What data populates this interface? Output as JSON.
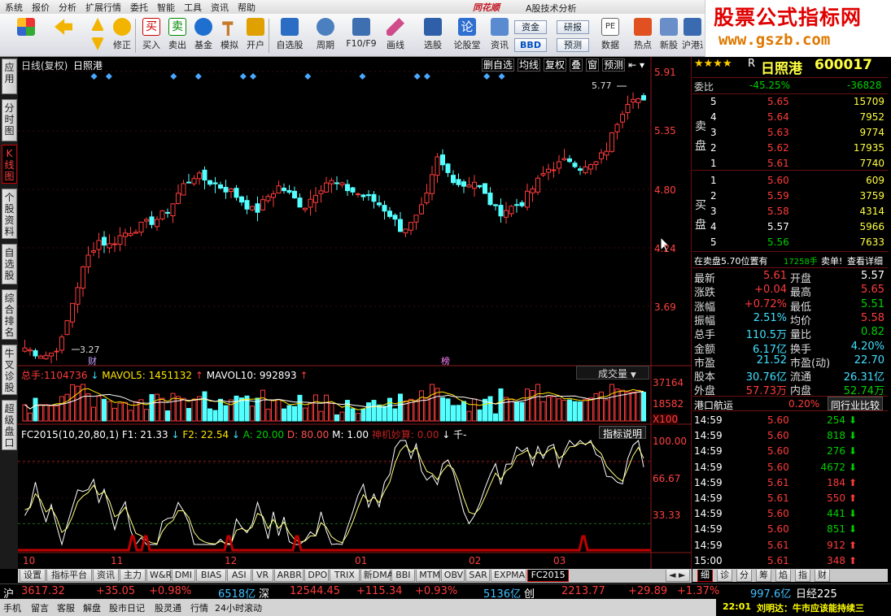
{
  "menu": {
    "items": [
      "系统",
      "报价",
      "分析",
      "扩展行情",
      "委托",
      "智能",
      "工具",
      "资讯",
      "帮助"
    ],
    "brand": "同花顺",
    "subtitle": "A股技术分析"
  },
  "banner": {
    "line1": "股票公式指标网",
    "line2": "www.gszb.com"
  },
  "toolbar": {
    "buttons": [
      "修正",
      "买入",
      "卖出",
      "基金",
      "模拟",
      "开户",
      "自选股",
      "周期",
      "F10/F9",
      "画线",
      "选股",
      "论股堂",
      "资讯",
      "数据",
      "热点",
      "新股",
      "沪港通"
    ],
    "box1": "资金",
    "box2": "BBD",
    "box3": "研报",
    "box4": "预测",
    "pe": "PE"
  },
  "left_tabs": [
    "应用",
    "分时图",
    "K线图",
    "个股资料",
    "自选股",
    "综合排名",
    "牛叉诊股",
    "超级盘口"
  ],
  "chart": {
    "title": "日线(复权)",
    "name": "日照港",
    "top_buttons": [
      "删自选",
      "均线",
      "复权",
      "叠",
      "窗",
      "预测"
    ],
    "price_axis": [
      "5.91",
      "5.35",
      "4.80",
      "4.24",
      "3.69"
    ],
    "high_label": "5.77",
    "low_label": "3.27",
    "markers": {
      "cai": "财",
      "bang": "榜"
    },
    "volume_legend": {
      "total_label": "总手:",
      "total": "1104736",
      "mav5_label": "MAVOL5:",
      "mav5": "1451132",
      "mav10_label": "MAVOL10:",
      "mav10": "992893",
      "dropdown": "成交量"
    },
    "volume_axis": [
      "37164",
      "18582",
      "X100"
    ],
    "indicator_legend": {
      "name": "FC2015(10,20,80,1)",
      "f1": "F1: 21.33",
      "f2": "F2: 22.54",
      "a": "A: 20.00",
      "d": "D: 80.00",
      "m": "M: 1.00",
      "signal": "神机妙算: 0.00",
      "extra": "千-",
      "help": "指标说明"
    },
    "indicator_axis": [
      "100.00",
      "66.67",
      "33.33"
    ],
    "date_axis": [
      "10",
      "11",
      "12",
      "01",
      "02",
      "03"
    ]
  },
  "bottom_tabs": [
    "设置",
    "指标平台",
    "资讯",
    "主力",
    "W&R",
    "DMI",
    "BIAS",
    "ASI",
    "VR",
    "ARBR",
    "DPO",
    "TRIX",
    "新DMA",
    "BBI",
    "MTM",
    "OBV",
    "SAR",
    "EXPMA",
    "FC2015"
  ],
  "right_bottom_tabs": [
    "细",
    "诊",
    "分",
    "筹",
    "焰",
    "指",
    "财"
  ],
  "quote": {
    "stars": "★★★★",
    "rating": "R",
    "name": "日照港",
    "code": "600017",
    "wb_label": "委比",
    "wb_pct": "-45.25%",
    "wb_num": "-36828",
    "sell_label": "卖盘",
    "buy_label": "买盘",
    "sell": [
      {
        "lvl": "5",
        "price": "5.65",
        "vol": "15709"
      },
      {
        "lvl": "4",
        "price": "5.64",
        "vol": "7952"
      },
      {
        "lvl": "3",
        "price": "5.63",
        "vol": "9774"
      },
      {
        "lvl": "2",
        "price": "5.62",
        "vol": "17935"
      },
      {
        "lvl": "1",
        "price": "5.61",
        "vol": "7740"
      }
    ],
    "buy": [
      {
        "lvl": "1",
        "price": "5.60",
        "vol": "609"
      },
      {
        "lvl": "2",
        "price": "5.59",
        "vol": "3759"
      },
      {
        "lvl": "3",
        "price": "5.58",
        "vol": "4314"
      },
      {
        "lvl": "4",
        "price": "5.57",
        "vol": "5966"
      },
      {
        "lvl": "5",
        "price": "5.56",
        "vol": "7633"
      }
    ],
    "notice": "在卖盘5.70位置有",
    "notice_vol": "17258手",
    "notice_type": "卖单!",
    "notice_link": "查看详细",
    "stats": [
      {
        "l1": "最新",
        "v1": "5.61",
        "l2": "开盘",
        "v2": "5.57"
      },
      {
        "l1": "涨跌",
        "v1": "+0.04",
        "l2": "最高",
        "v2": "5.65"
      },
      {
        "l1": "涨幅",
        "v1": "+0.72%",
        "l2": "最低",
        "v2": "5.51"
      },
      {
        "l1": "振幅",
        "v1": "2.51%",
        "l2": "均价",
        "v2": "5.58"
      },
      {
        "l1": "总手",
        "v1": "110.5万",
        "l2": "量比",
        "v2": "0.82"
      },
      {
        "l1": "金额",
        "v1": "6.17亿",
        "l2": "换手",
        "v2": "4.20%"
      },
      {
        "l1": "市盈",
        "v1": "21.52",
        "l2": "市盈(动)",
        "v2": "22.70"
      },
      {
        "l1": "股本",
        "v1": "30.76亿",
        "l2": "流通",
        "v2": "26.31亿"
      },
      {
        "l1": "外盘",
        "v1": "57.73万",
        "l2": "内盘",
        "v2": "52.74万"
      }
    ],
    "sector": "港口航运",
    "sector_pct": "0.20%",
    "sector_btn": "同行业比较",
    "ticks": [
      {
        "t": "14:59",
        "p": "5.60",
        "v": "254",
        "d": "down"
      },
      {
        "t": "14:59",
        "p": "5.60",
        "v": "818",
        "d": "down"
      },
      {
        "t": "14:59",
        "p": "5.60",
        "v": "276",
        "d": "down"
      },
      {
        "t": "14:59",
        "p": "5.60",
        "v": "4672",
        "d": "down"
      },
      {
        "t": "14:59",
        "p": "5.61",
        "v": "184",
        "d": "up"
      },
      {
        "t": "14:59",
        "p": "5.61",
        "v": "550",
        "d": "up"
      },
      {
        "t": "14:59",
        "p": "5.60",
        "v": "441",
        "d": "down"
      },
      {
        "t": "14:59",
        "p": "5.60",
        "v": "851",
        "d": "down"
      },
      {
        "t": "14:59",
        "p": "5.61",
        "v": "912",
        "d": "up"
      },
      {
        "t": "15:00",
        "p": "5.61",
        "v": "348",
        "d": "up"
      }
    ]
  },
  "status": {
    "sh": "沪",
    "sh_idx": "3617.32",
    "sh_chg": "+35.05",
    "sh_pct": "+0.98%",
    "sh_amt": "6518亿",
    "sz": "深",
    "sz_idx": "12544.45",
    "sz_chg": "+115.34",
    "sz_pct": "+0.93%",
    "sz_amt": "5136亿",
    "cy": "创",
    "cy_idx": "2213.77",
    "cy_chg": "+29.89",
    "cy_pct": "+1.37%",
    "cy_amt": "997.6亿",
    "rz": "日经225"
  },
  "footer": {
    "items": [
      "手机",
      "留言",
      "客服",
      "解盘",
      "股市日记",
      "股灵通",
      "行情",
      "24小时滚动"
    ],
    "time": "22:01",
    "news": "刘明达：牛市应该能持续三"
  },
  "colors": {
    "up": "#ff3b3b",
    "down": "#00d000",
    "candle_down": "#54ffff",
    "axis": "#8b1a1a",
    "text_red": "#ff4040"
  }
}
